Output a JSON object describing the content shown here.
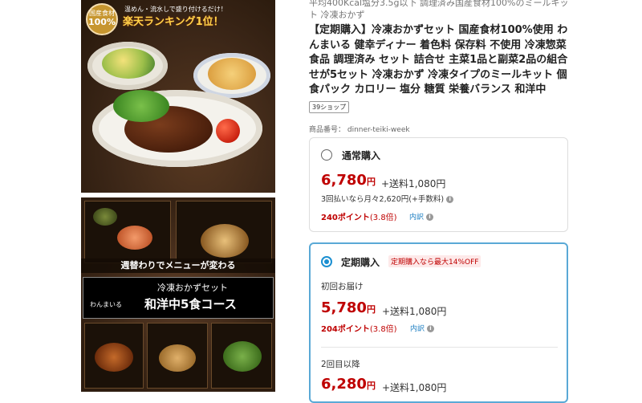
{
  "product_images": {
    "image1": {
      "badge_line1": "国産食材",
      "badge_line2": "100%",
      "promo_line1": "温めん・流水しで盛り付けるだけ！",
      "promo_line2": "楽天ランキング1位！"
    },
    "image2": {
      "banner_text": "週替わりでメニューが変わる",
      "logo_text": "わんまいる",
      "course_line1": "冷凍おかずセット",
      "course_line2": "和洋中5食コース"
    }
  },
  "product": {
    "subtitle": "平均400Kcal塩分3.5g以下 調理済み国産食材100%のミールキット 冷凍おかず",
    "title": "【定期購入】冷凍おかずセット 国産食材100%使用 わんまいる 健幸ディナー 着色料 保存料 不使用 冷凍惣菜 食品 調理済み セット 詰合せ 主菜1品と副菜2品の組合せが5セット 冷凍おかず 冷凍タイプのミールキット 個食パック カロリー 塩分 糖質 栄養バランス 和洋中",
    "shop_tag": "39ショップ",
    "item_number": "商品番号： dinner-teiki-week"
  },
  "purchase": {
    "normal": {
      "label": "通常購入",
      "price": "6,780",
      "yen": "円",
      "shipping": "+送料1,080円",
      "installment": "3回払いなら月々2,620円(+手数料)",
      "points": "240ポイント",
      "rate": "(3.8倍)",
      "breakdown": "内訳"
    },
    "subscription": {
      "label": "定期購入",
      "discount_badge": "定期購入なら最大14%OFF",
      "first_label": "初回お届け",
      "first_price": "5,780",
      "yen": "円",
      "first_shipping": "+送料1,080円",
      "first_points": "204ポイント",
      "first_rate": "(3.8倍)",
      "breakdown": "内訳",
      "second_label": "2回目以降",
      "second_price": "6,280",
      "second_shipping": "+送料1,080円"
    }
  },
  "colors": {
    "price": "#bf0000",
    "accent": "#1b8fd1",
    "link": "#1b7ec2"
  }
}
